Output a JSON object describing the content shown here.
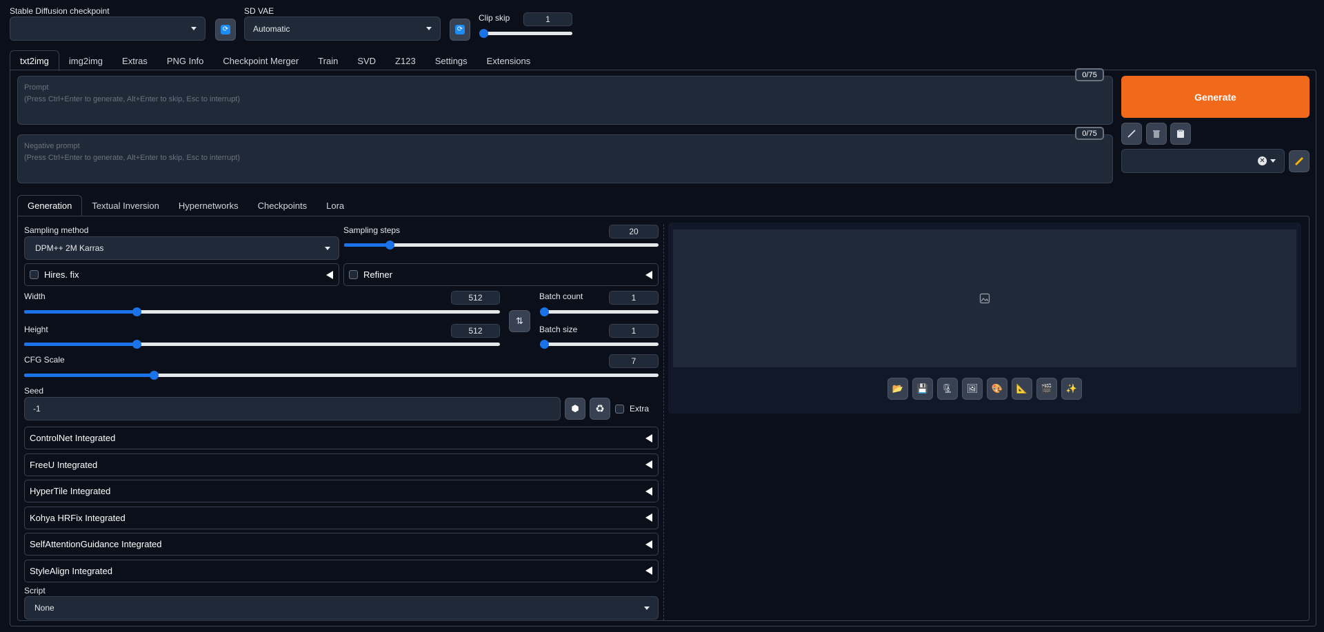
{
  "top": {
    "checkpoint_label": "Stable Diffusion checkpoint",
    "checkpoint_value": "",
    "vae_label": "SD VAE",
    "vae_value": "Automatic",
    "clip_skip_label": "Clip skip",
    "clip_skip_value": "1",
    "clip_skip_min": 1,
    "clip_skip_max": 12,
    "clip_skip_current": 1
  },
  "main_tabs": [
    "txt2img",
    "img2img",
    "Extras",
    "PNG Info",
    "Checkpoint Merger",
    "Train",
    "SVD",
    "Z123",
    "Settings",
    "Extensions"
  ],
  "prompt": {
    "placeholder_line1": "Prompt",
    "placeholder_line2": "(Press Ctrl+Enter to generate, Alt+Enter to skip, Esc to interrupt)",
    "counter": "0/75"
  },
  "negative_prompt": {
    "placeholder_line1": "Negative prompt",
    "placeholder_line2": "(Press Ctrl+Enter to generate, Alt+Enter to skip, Esc to interrupt)",
    "counter": "0/75"
  },
  "generate_label": "Generate",
  "sub_tabs": [
    "Generation",
    "Textual Inversion",
    "Hypernetworks",
    "Checkpoints",
    "Lora"
  ],
  "sampling": {
    "method_label": "Sampling method",
    "method_value": "DPM++ 2M Karras",
    "steps_label": "Sampling steps",
    "steps_value": "20",
    "steps_fraction": 0.136
  },
  "hires_label": "Hires. fix",
  "refiner_label": "Refiner",
  "width": {
    "label": "Width",
    "value": "512",
    "fraction": 0.231
  },
  "height": {
    "label": "Height",
    "value": "512",
    "fraction": 0.231
  },
  "batch_count": {
    "label": "Batch count",
    "value": "1",
    "fraction": 0.0
  },
  "batch_size": {
    "label": "Batch size",
    "value": "1",
    "fraction": 0.0
  },
  "cfg": {
    "label": "CFG Scale",
    "value": "7",
    "fraction": 0.2
  },
  "seed": {
    "label": "Seed",
    "value": "-1",
    "extra_label": "Extra"
  },
  "accordions": [
    "ControlNet Integrated",
    "FreeU Integrated",
    "HyperTile Integrated",
    "Kohya HRFix Integrated",
    "SelfAttentionGuidance Integrated",
    "StyleAlign Integrated"
  ],
  "script": {
    "label": "Script",
    "value": "None"
  },
  "icons": {
    "refresh": "refresh-icon",
    "swap": "swap-dimensions-icon",
    "dice": "dice-icon",
    "recycle": "recycle-icon",
    "image_placeholder": "image-icon",
    "output_tools": [
      "folder-icon",
      "save-icon",
      "zip-icon",
      "image-icon",
      "palette-icon",
      "ruler-icon",
      "clapper-icon",
      "sparkles-icon"
    ]
  },
  "colors": {
    "background": "#0b0f19",
    "generate": "#f16a1b",
    "slider": "#1a73e8",
    "refresh": "#1d8cf8"
  }
}
